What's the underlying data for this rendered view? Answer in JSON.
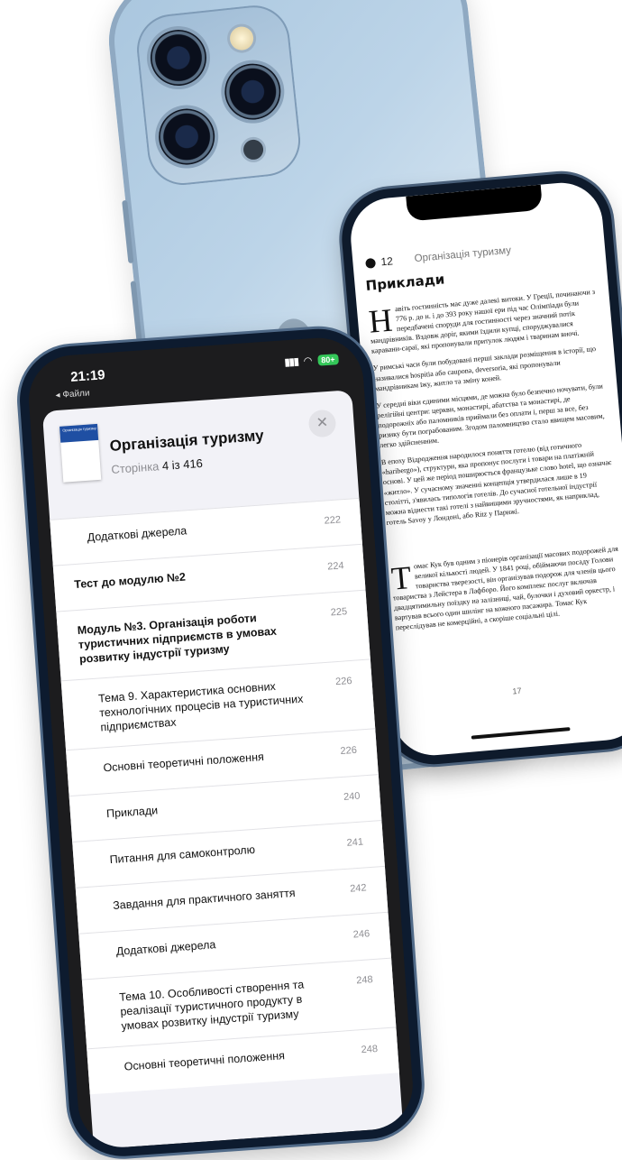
{
  "reader": {
    "timer": "12",
    "book_title": "Організація туризму",
    "section_title": "Приклади",
    "paragraphs": [
      {
        "dropcap": "Н",
        "text": "авіть гостинність має дуже далекі витоки. У Греції, починаючи з 776 р. до н. і до 393 року нашої ери під час Олімпіади були передбачені споруди для гостинності через значний потік мандрівників. Вздовж доріг, якими їздили купці, споруджувалися каравани-сараї, які пропонували притулок людям і тваринам вночі."
      },
      {
        "dropcap": "",
        "text": "У римські часи були побудовані перші заклади розміщення в історії, що називалися hospitia або caupona, deversoria, які пропонували мандрівникам їжу, житло та зміну коней."
      },
      {
        "dropcap": "",
        "text": "У середні віки єдиними місцями, де можна було безпечно ночувати, були релігійні центри: церкви, монастирі, абатства та монастирі, де подорожніх або паломників приймали без оплати і, перш за все, без ризику бути пограбованим. Згодом паломництво стало явищем масовим, легко здійсненним."
      },
      {
        "dropcap": "",
        "text": "В епоху Відродження народилося поняття готелю (від готичного «haribergo»), структури, яка пропонує послуги і товари на платіжній основі. У цей же період поширюється французьке слово hotel, що означає «житло». У сучасному значенні концепція утвердилася лише в 19 столітті, з'явилась типологія готелів. До сучасної готельної індустрії можна віднести такі готелі з найвищими зручностями, як наприклад, готель Savoy у Лондоні, або Ritz у Парижі."
      },
      {
        "dropcap": "Т",
        "text": "омас Кук був одним з піонерів організації масових подорожей для великої кількості людей. У 1841 році, обіймаючи посаду Голови товариства тверезості, він організував подорож для членів цього товариства з Лейстера в Лафборо. Його комплекс послуг включав двадцятимильну поїздку на залізниці, чай, булочки і духовий оркестр, і вартував всього один шилінг на кожного пасажира. Томас Кук переслідував не комерційні, а скоріше соціальні цілі."
      }
    ],
    "page_number": "17"
  },
  "status_bar": {
    "time": "21:19",
    "back_label": "◂ Файли",
    "battery": "80+"
  },
  "book": {
    "cover_text": "Організація туризму",
    "title": "Організація туризму",
    "page_label": "Сторінка",
    "page_value": "4 із 416"
  },
  "toc": [
    {
      "label": "Додаткові джерела",
      "page": "222",
      "indent": true,
      "bold": false
    },
    {
      "label": "Тест до модулю №2",
      "page": "224",
      "indent": false,
      "bold": true
    },
    {
      "label": "Модуль №3. Організація роботи туристичних підприємств в умовах розвитку індустрії туризму",
      "page": "225",
      "indent": false,
      "bold": true
    },
    {
      "label": "Тема 9. Характеристика основних технологічних процесів на туристичних підприємствах",
      "page": "226",
      "indent": true,
      "bold": false
    },
    {
      "label": "Основні теоретичні положення",
      "page": "226",
      "indent": true,
      "bold": false
    },
    {
      "label": "Приклади",
      "page": "240",
      "indent": true,
      "bold": false
    },
    {
      "label": "Питання для самоконтролю",
      "page": "241",
      "indent": true,
      "bold": false
    },
    {
      "label": "Завдання для практичного заняття",
      "page": "242",
      "indent": true,
      "bold": false
    },
    {
      "label": "Додаткові джерела",
      "page": "246",
      "indent": true,
      "bold": false
    },
    {
      "label": "Тема 10. Особливості створення та реалізації туристичного продукту в умовах розвитку індустрії туризму",
      "page": "248",
      "indent": true,
      "bold": false
    },
    {
      "label": "Основні теоретичні положення",
      "page": "248",
      "indent": true,
      "bold": false
    }
  ]
}
